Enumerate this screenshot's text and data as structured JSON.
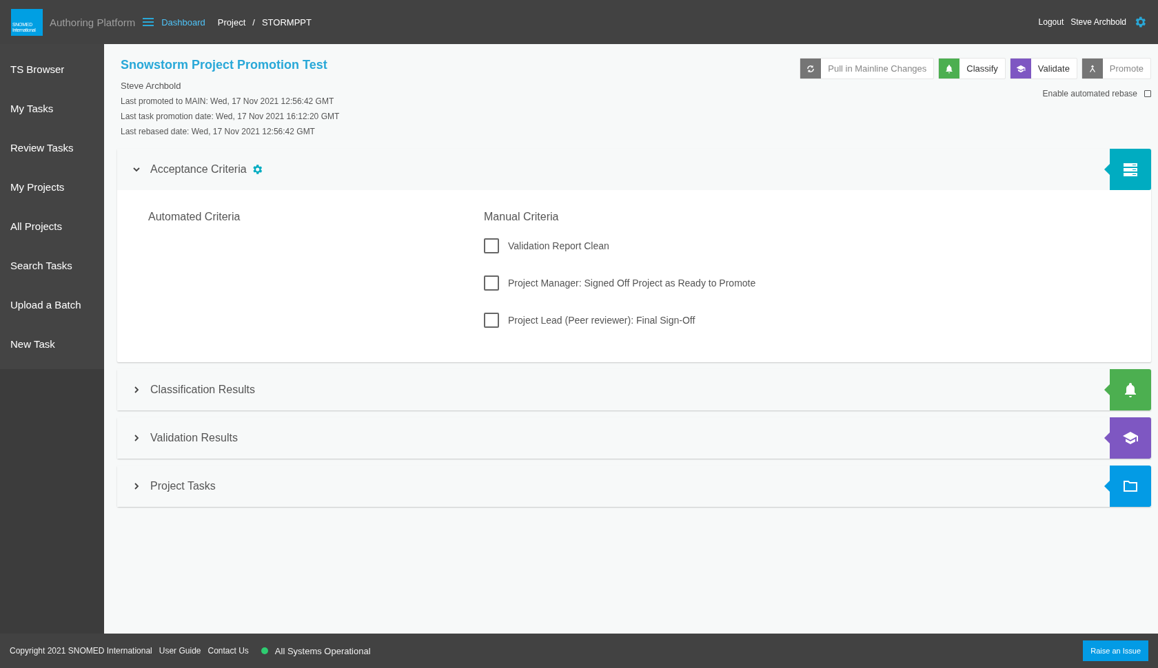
{
  "header": {
    "logo": [
      "SNOMED",
      "International"
    ],
    "app_name": "Authoring Platform",
    "dashboard": "Dashboard",
    "breadcrumbs": [
      "Project",
      "STORMPPT"
    ],
    "separator": "/",
    "logout": "Logout",
    "user": "Steve Archbold"
  },
  "sidebar": {
    "items": [
      {
        "label": "TS Browser"
      },
      {
        "label": "My Tasks"
      },
      {
        "label": "Review Tasks"
      },
      {
        "label": "My Projects"
      },
      {
        "label": "All Projects"
      },
      {
        "label": "Search Tasks"
      },
      {
        "label": "Upload a Batch"
      },
      {
        "label": "New Task"
      }
    ]
  },
  "project": {
    "title": "Snowstorm Project Promotion Test",
    "owner": "Steve Archbold",
    "details": [
      "Last promoted to MAIN: Wed, 17 Nov 2021 12:56:42 GMT",
      "Last task promotion date: Wed, 17 Nov 2021 16:12:20 GMT",
      "Last rebased date: Wed, 17 Nov 2021 12:56:42 GMT"
    ]
  },
  "actions": [
    {
      "label": "Pull in Mainline Changes",
      "kind": "sync",
      "color": "#757575",
      "disabled": true
    },
    {
      "label": "Classify",
      "kind": "bell",
      "color": "#4caf50",
      "disabled": false
    },
    {
      "label": "Validate",
      "kind": "cap",
      "color": "#7e57c2",
      "disabled": false
    },
    {
      "label": "Promote",
      "kind": "merge",
      "color": "#757575",
      "disabled": true
    }
  ],
  "auto_rebase": {
    "label": "Enable automated rebase",
    "checked": false
  },
  "panels": [
    {
      "title": "Acceptance Criteria",
      "expanded": true,
      "settings": true,
      "kind": "list",
      "color": "#00acc1",
      "automated_title": "Automated Criteria",
      "manual_title": "Manual Criteria",
      "manual": [
        {
          "label": "Validation Report Clean",
          "checked": false
        },
        {
          "label": "Project Manager: Signed Off Project as Ready to Promote",
          "checked": false
        },
        {
          "label": "Project Lead (Peer reviewer): Final Sign-Off",
          "checked": false
        }
      ]
    },
    {
      "title": "Classification Results",
      "expanded": false,
      "kind": "bell",
      "color": "#4caf50"
    },
    {
      "title": "Validation Results",
      "expanded": false,
      "kind": "cap",
      "color": "#7e57c2"
    },
    {
      "title": "Project Tasks",
      "expanded": false,
      "kind": "folder",
      "color": "#039be5"
    }
  ],
  "footer": {
    "copyright": "Copyright 2021 SNOMED International",
    "links": [
      "User Guide",
      "Contact Us"
    ],
    "status": {
      "label": "All Systems Operational",
      "color": "#2ecc71"
    },
    "raise": "Raise an Issue"
  }
}
